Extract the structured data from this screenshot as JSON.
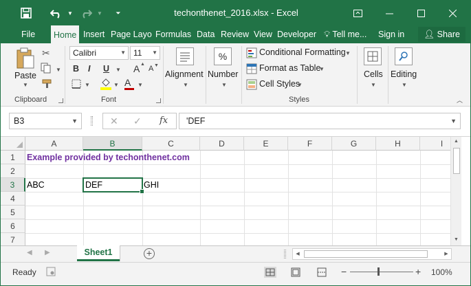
{
  "app": {
    "title": "techonthenet_2016.xlsx - Excel",
    "accent": "#217346"
  },
  "quick_access": {
    "undo_icon": "undo-icon",
    "redo_icon": "redo-icon",
    "save_icon": "save-icon"
  },
  "tabs": [
    {
      "label": "File"
    },
    {
      "label": "Home"
    },
    {
      "label": "Insert"
    },
    {
      "label": "Page Layo"
    },
    {
      "label": "Formulas"
    },
    {
      "label": "Data"
    },
    {
      "label": "Review"
    },
    {
      "label": "View"
    },
    {
      "label": "Developer"
    }
  ],
  "tell_me": "Tell me...",
  "sign_in": "Sign in",
  "share": "Share",
  "ribbon": {
    "clipboard": {
      "paste": "Paste",
      "group_label": "Clipboard"
    },
    "font": {
      "name": "Calibri",
      "size": "11",
      "bold": "B",
      "italic": "I",
      "underline": "U",
      "grow": "A",
      "shrink": "A",
      "group_label": "Font"
    },
    "alignment": {
      "label": "Alignment"
    },
    "number": {
      "label": "Number",
      "symbol": "%"
    },
    "styles": {
      "conditional_formatting": "Conditional Formatting",
      "format_as_table": "Format as Table",
      "cell_styles": "Cell Styles",
      "group_label": "Styles"
    },
    "cells": {
      "label": "Cells"
    },
    "editing": {
      "label": "Editing"
    }
  },
  "formula_bar": {
    "name_box": "B3",
    "fx": "fx",
    "cancel": "✕",
    "enter": "✓",
    "value": "'DEF"
  },
  "grid": {
    "columns": [
      "A",
      "B",
      "C",
      "D",
      "E",
      "F",
      "G",
      "H",
      "I"
    ],
    "rows": [
      "1",
      "2",
      "3",
      "4",
      "5",
      "6",
      "7"
    ],
    "cells": {
      "A1": "Example provided by techonthenet.com",
      "A3": "ABC",
      "B3": "DEF",
      "C3": "GHI"
    },
    "selected_cell": "B3"
  },
  "sheets": [
    {
      "label": "Sheet1"
    }
  ],
  "add_sheet": "+",
  "status": {
    "ready": "Ready",
    "zoom_out": "−",
    "zoom_in": "+",
    "zoom_level": "100%"
  }
}
